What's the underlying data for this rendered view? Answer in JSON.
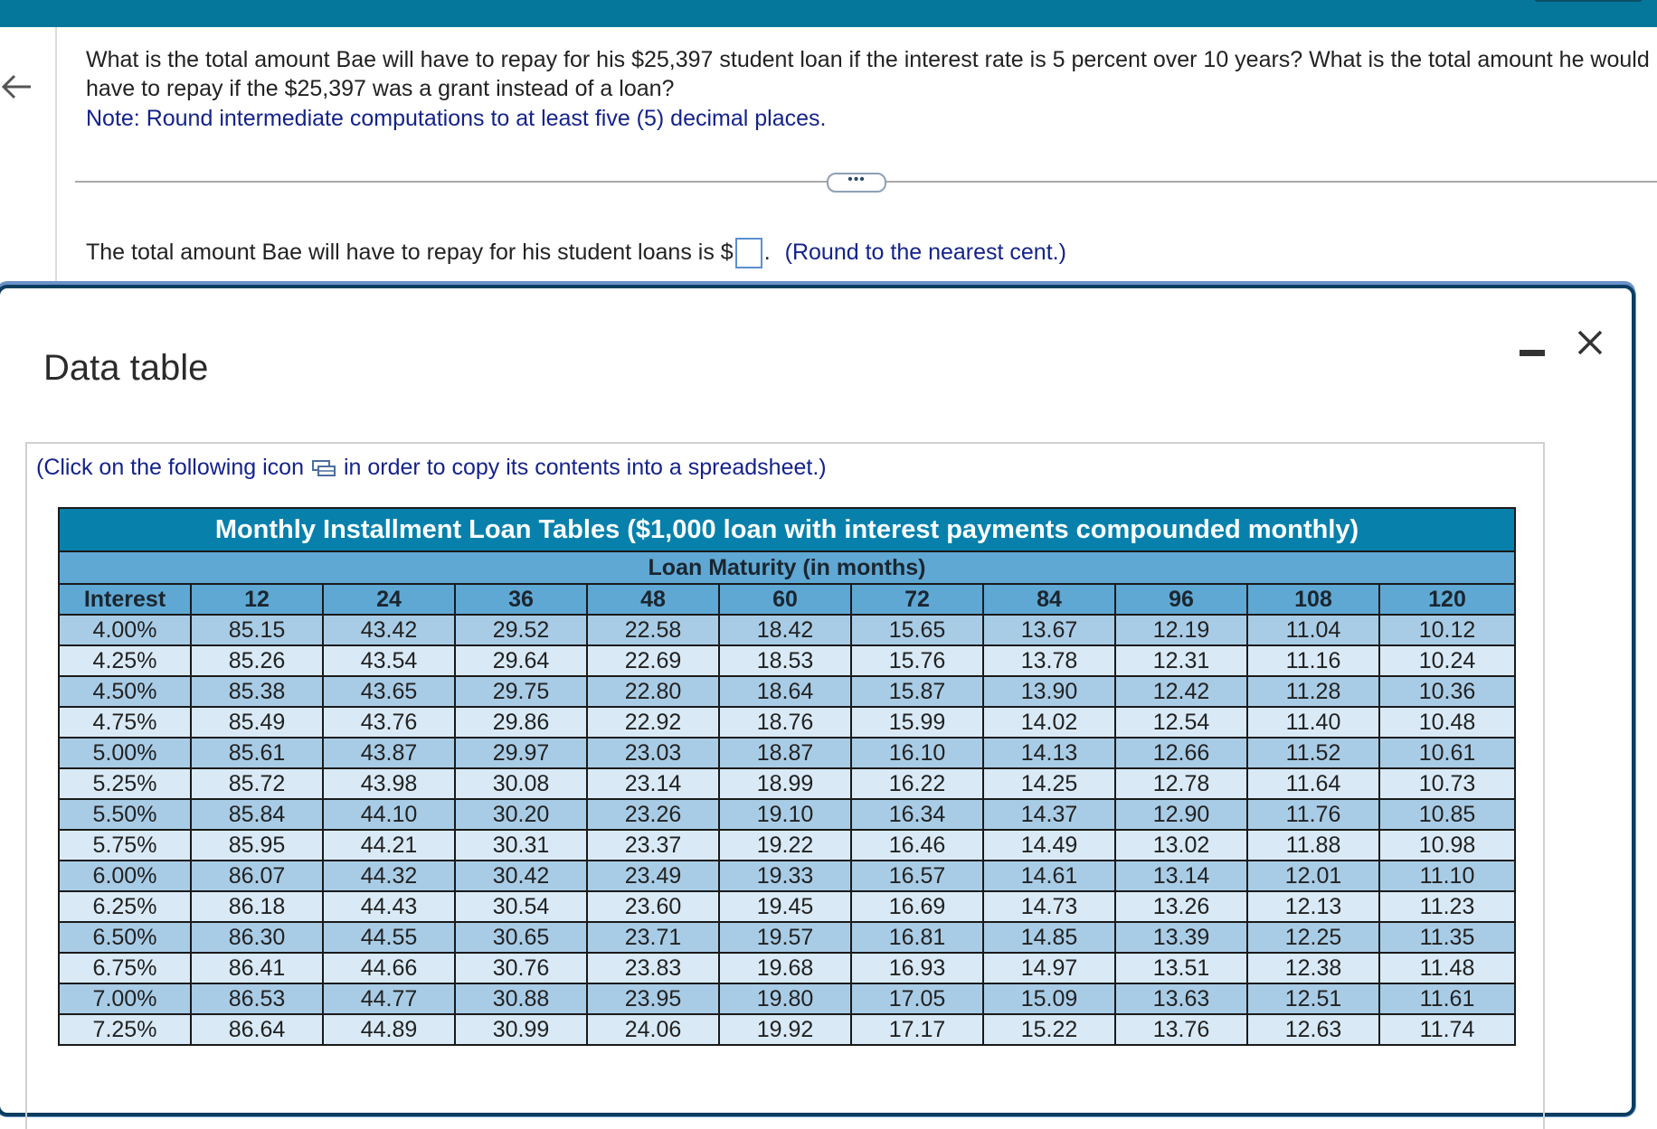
{
  "question": {
    "text": "What is the total amount Bae will have to repay for his $25,397 student loan if the interest rate is 5 percent over 10 years? What is the total amount he would have to repay if the $25,397 was a grant instead of a loan?",
    "note": "Note: Round intermediate computations to at least five (5) decimal places."
  },
  "answer": {
    "prefix": "The total amount Bae will have to repay for his student loans is $",
    "input_value": "",
    "suffix": ".",
    "hint": "(Round to the nearest cent.)"
  },
  "modal": {
    "title": "Data table",
    "copy_before": "(Click on the following icon",
    "copy_after": "in order to copy its contents into a spreadsheet.)"
  },
  "table": {
    "title": "Monthly Installment Loan Tables ($1,000 loan with interest payments compounded monthly)",
    "subtitle": "Loan Maturity (in months)",
    "headers": [
      "Interest",
      "12",
      "24",
      "36",
      "48",
      "60",
      "72",
      "84",
      "96",
      "108",
      "120"
    ],
    "rows": [
      [
        "4.00%",
        "85.15",
        "43.42",
        "29.52",
        "22.58",
        "18.42",
        "15.65",
        "13.67",
        "12.19",
        "11.04",
        "10.12"
      ],
      [
        "4.25%",
        "85.26",
        "43.54",
        "29.64",
        "22.69",
        "18.53",
        "15.76",
        "13.78",
        "12.31",
        "11.16",
        "10.24"
      ],
      [
        "4.50%",
        "85.38",
        "43.65",
        "29.75",
        "22.80",
        "18.64",
        "15.87",
        "13.90",
        "12.42",
        "11.28",
        "10.36"
      ],
      [
        "4.75%",
        "85.49",
        "43.76",
        "29.86",
        "22.92",
        "18.76",
        "15.99",
        "14.02",
        "12.54",
        "11.40",
        "10.48"
      ],
      [
        "5.00%",
        "85.61",
        "43.87",
        "29.97",
        "23.03",
        "18.87",
        "16.10",
        "14.13",
        "12.66",
        "11.52",
        "10.61"
      ],
      [
        "5.25%",
        "85.72",
        "43.98",
        "30.08",
        "23.14",
        "18.99",
        "16.22",
        "14.25",
        "12.78",
        "11.64",
        "10.73"
      ],
      [
        "5.50%",
        "85.84",
        "44.10",
        "30.20",
        "23.26",
        "19.10",
        "16.34",
        "14.37",
        "12.90",
        "11.76",
        "10.85"
      ],
      [
        "5.75%",
        "85.95",
        "44.21",
        "30.31",
        "23.37",
        "19.22",
        "16.46",
        "14.49",
        "13.02",
        "11.88",
        "10.98"
      ],
      [
        "6.00%",
        "86.07",
        "44.32",
        "30.42",
        "23.49",
        "19.33",
        "16.57",
        "14.61",
        "13.14",
        "12.01",
        "11.10"
      ],
      [
        "6.25%",
        "86.18",
        "44.43",
        "30.54",
        "23.60",
        "19.45",
        "16.69",
        "14.73",
        "13.26",
        "12.13",
        "11.23"
      ],
      [
        "6.50%",
        "86.30",
        "44.55",
        "30.65",
        "23.71",
        "19.57",
        "16.81",
        "14.85",
        "13.39",
        "12.25",
        "11.35"
      ],
      [
        "6.75%",
        "86.41",
        "44.66",
        "30.76",
        "23.83",
        "19.68",
        "16.93",
        "14.97",
        "13.51",
        "12.38",
        "11.48"
      ],
      [
        "7.00%",
        "86.53",
        "44.77",
        "30.88",
        "23.95",
        "19.80",
        "17.05",
        "15.09",
        "13.63",
        "12.51",
        "11.61"
      ],
      [
        "7.25%",
        "86.64",
        "44.89",
        "30.99",
        "24.06",
        "19.92",
        "17.17",
        "15.22",
        "13.76",
        "12.63",
        "11.74"
      ]
    ]
  },
  "icons": {
    "back": "arrow-left-icon",
    "more": "ellipsis-icon",
    "copy": "spreadsheet-copy-icon",
    "minimize": "minimize-icon",
    "close": "close-icon"
  },
  "colors": {
    "topbar": "#05779b",
    "title_bg": "#0781ab",
    "header_bg": "#5fa8d3",
    "row_dark": "#a9cce6",
    "row_light": "#d9eaf6",
    "link_text": "#14238a"
  }
}
